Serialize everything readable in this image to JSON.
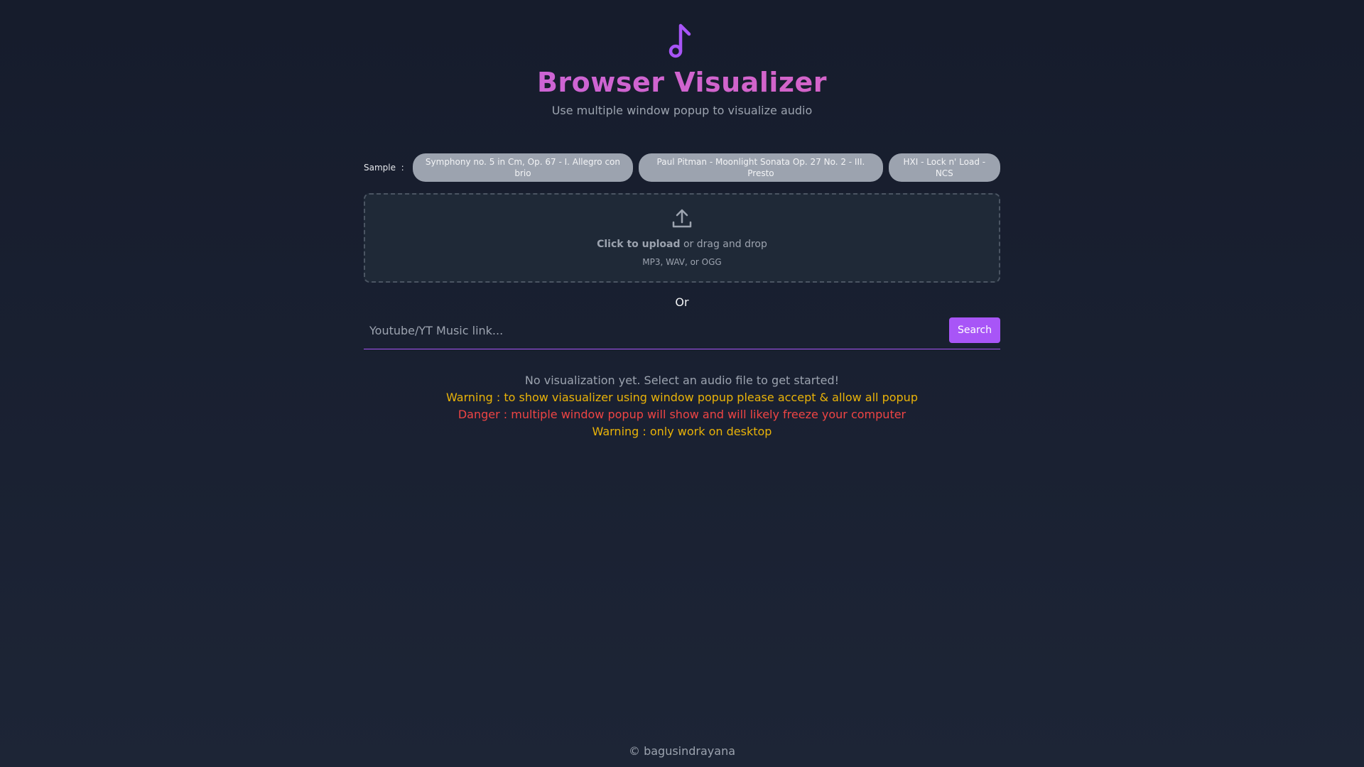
{
  "app": {
    "title": "Browser Visualizer",
    "subtitle": "Use multiple window popup to visualize audio",
    "icon": "music-note-icon"
  },
  "samples": {
    "label": "Sample",
    "separator": ":",
    "items": [
      "Symphony no. 5 in Cm, Op. 67 - I. Allegro con brio",
      "Paul Pitman - Moonlight Sonata Op. 27 No. 2 - III. Presto",
      "HXI - Lock n' Load - NCS"
    ]
  },
  "upload": {
    "icon": "upload-icon",
    "click_text": "Click to upload",
    "drag_text": " or drag and drop",
    "formats": "MP3, WAV, or OGG"
  },
  "divider_text": "Or",
  "search": {
    "placeholder": "Youtube/YT Music link...",
    "button_label": "Search"
  },
  "messages": {
    "empty_state": "No visualization yet. Select an audio file to get started!",
    "warning_popup": "Warning : to show viasualizer using window popup please accept & allow all popup",
    "danger": "Danger : multiple window popup will show and will likely freeze your computer",
    "warning_desktop": "Warning : only work on desktop"
  },
  "footer": {
    "copyright": "© bagusindrayana"
  },
  "colors": {
    "accent": "#a855f7",
    "title_gradient_start": "#c064e8",
    "title_gradient_end": "#e063b4",
    "warning": "#eab308",
    "danger": "#ef4444",
    "background": "#161c2c"
  }
}
